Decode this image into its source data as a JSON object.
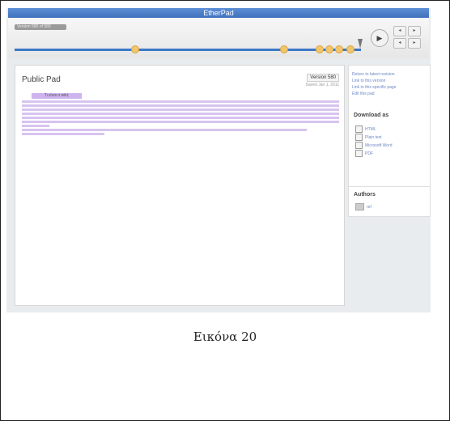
{
  "app": {
    "title": "EtherPad"
  },
  "timeslider": {
    "label": "Version 580 of 580",
    "play_symbol": "▶",
    "step_back_symbol": "◂",
    "step_fwd_symbol": "▸"
  },
  "pad": {
    "title": "Public Pad",
    "version_label": "Version 580",
    "saved_label": "Saved Jan 1, 2011",
    "heading_label": "Τι είναι ο wiki;"
  },
  "sidebar": {
    "links": [
      "Return to latest revision",
      "Link to this version",
      "Link to this specific page",
      "Edit this pad"
    ],
    "download_title": "Download as",
    "export_items": [
      "HTML",
      "Plain text",
      "Microsoft Word",
      "PDF"
    ],
    "authors_title": "Authors",
    "authors": [
      "ref"
    ]
  },
  "caption": "Εικόνα 20"
}
